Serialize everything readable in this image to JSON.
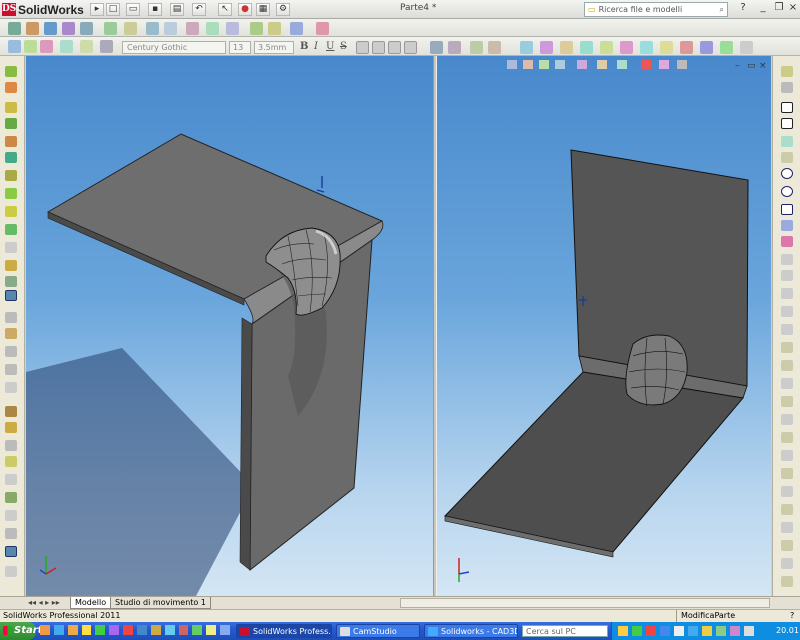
{
  "app": {
    "brand": "SolidWorks",
    "logo_mark": "DS",
    "document_title": "Parte4 *"
  },
  "search": {
    "placeholder": "Ricerca file e modelli"
  },
  "format_toolbar": {
    "font": "Century Gothic",
    "size": "13",
    "height": "3.5mm",
    "bold": "B",
    "italic": "I",
    "underline": "U",
    "strike": "S"
  },
  "tabs": [
    {
      "label": "Modello"
    },
    {
      "label": "Studio di movimento 1"
    }
  ],
  "status": {
    "left": "SolidWorks Professional 2011",
    "right": "ModificaParte"
  },
  "taskbar": {
    "start": "Start",
    "tasks": [
      {
        "label": "SolidWorks Profess...",
        "active": true
      },
      {
        "label": "CamStudio",
        "active": false
      },
      {
        "label": "Solidworks - CAD3D.it...",
        "active": false
      }
    ],
    "search_placeholder": "Cerca sul PC",
    "clock": "20.01"
  },
  "colors": {
    "accent": "#c8102e",
    "viewport_top": "#4888cc",
    "viewport_bottom": "#d4e6f4",
    "part": "#6b6b6b"
  }
}
